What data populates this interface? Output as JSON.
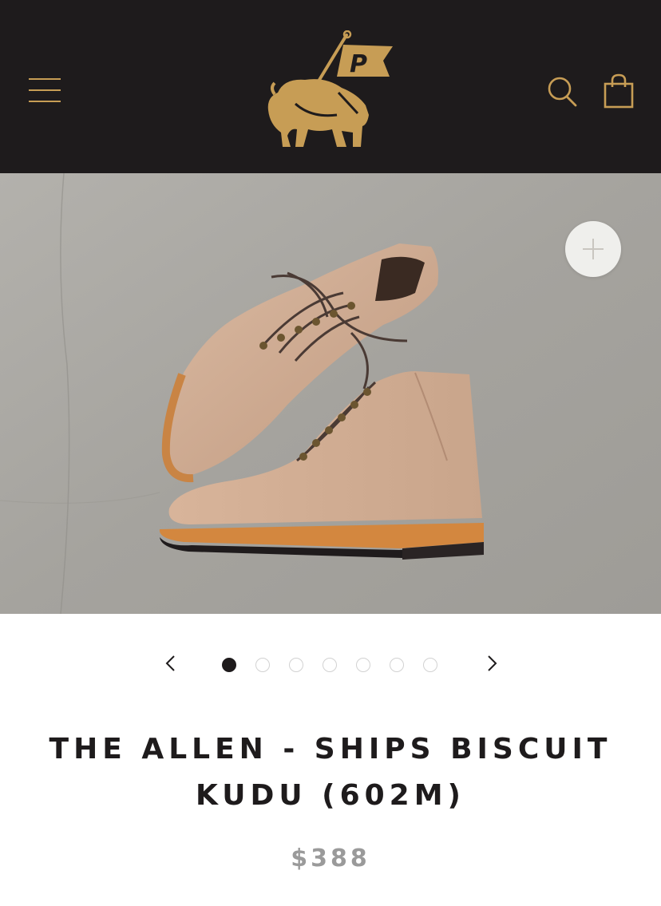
{
  "brand": {
    "logo_letter": "P",
    "colors": {
      "header_bg": "#1e1b1c",
      "accent_gold": "#c79d55"
    }
  },
  "header": {
    "menu_icon": "hamburger-menu-icon",
    "search_icon": "search-icon",
    "cart_icon": "shopping-bag-icon"
  },
  "gallery": {
    "zoom_icon": "plus-zoom-icon",
    "prev_icon": "chevron-left-icon",
    "next_icon": "chevron-right-icon",
    "slide_count": 7,
    "active_slide": 1
  },
  "product": {
    "title": "THE ALLEN - SHIPS BISCUIT KUDU (602M)",
    "price": "$388"
  }
}
